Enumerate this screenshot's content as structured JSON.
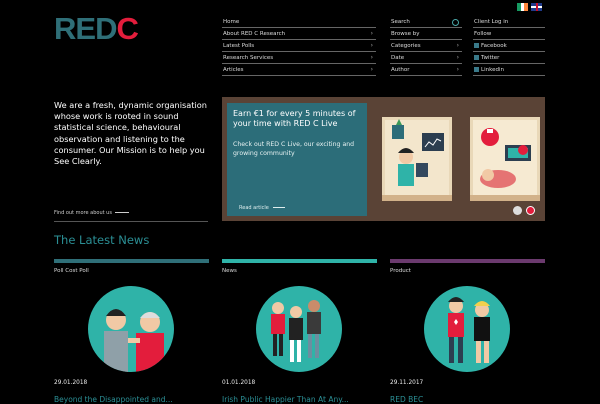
{
  "logo": {
    "part1": "RED",
    "part2": "C"
  },
  "colors": {
    "teal": "#2f6f78",
    "red": "#e31d3c",
    "accent": "#2b8f95"
  },
  "nav": {
    "col1": [
      {
        "label": "Home",
        "chevron": ""
      },
      {
        "label": "About RED C Research",
        "chevron": "›"
      },
      {
        "label": "Latest Polls",
        "chevron": "›"
      },
      {
        "label": "Research Services",
        "chevron": "›"
      },
      {
        "label": "Articles",
        "chevron": "›"
      }
    ],
    "col2": [
      {
        "label": "Search",
        "chevron": "",
        "search": true
      },
      {
        "label": "Browse by",
        "chevron": ""
      },
      {
        "label": "Categories",
        "chevron": "›"
      },
      {
        "label": "Date",
        "chevron": "›"
      },
      {
        "label": "Author",
        "chevron": "›"
      }
    ],
    "col3": [
      {
        "label": "Client Log in",
        "chevron": "",
        "icon": ""
      },
      {
        "label": "Follow",
        "chevron": "",
        "icon": ""
      },
      {
        "label": "Facebook",
        "chevron": "",
        "icon": "facebook"
      },
      {
        "label": "Twitter",
        "chevron": "",
        "icon": "twitter"
      },
      {
        "label": "Linkedin",
        "chevron": "",
        "icon": "linkedin"
      }
    ]
  },
  "intro": {
    "text": "We are a fresh, dynamic organisation whose work is rooted in sound statistical science, behavioural observation and listening to the consumer. Our Mission is to help you See Clearly.",
    "findout": "Find out more about us"
  },
  "banner": {
    "headline": "Earn €1 for every 5 minutes of your time with RED C Live",
    "subtext": "Check out RED C Live, our exciting and growing community",
    "read": "Read article"
  },
  "news": {
    "heading": "The Latest News",
    "items": [
      {
        "category": "Poll Cost Poll",
        "date": "29.01.2018",
        "title": "Beyond the Disappointed and...",
        "bar_color": "#2f6f78"
      },
      {
        "category": "News",
        "date": "01.01.2018",
        "title": "Irish Public Happier Than At Any...",
        "bar_color": "#2fb3a8"
      },
      {
        "category": "Product",
        "date": "29.11.2017",
        "title": "RED BEC",
        "bar_color": "#6b3a6e"
      }
    ]
  }
}
